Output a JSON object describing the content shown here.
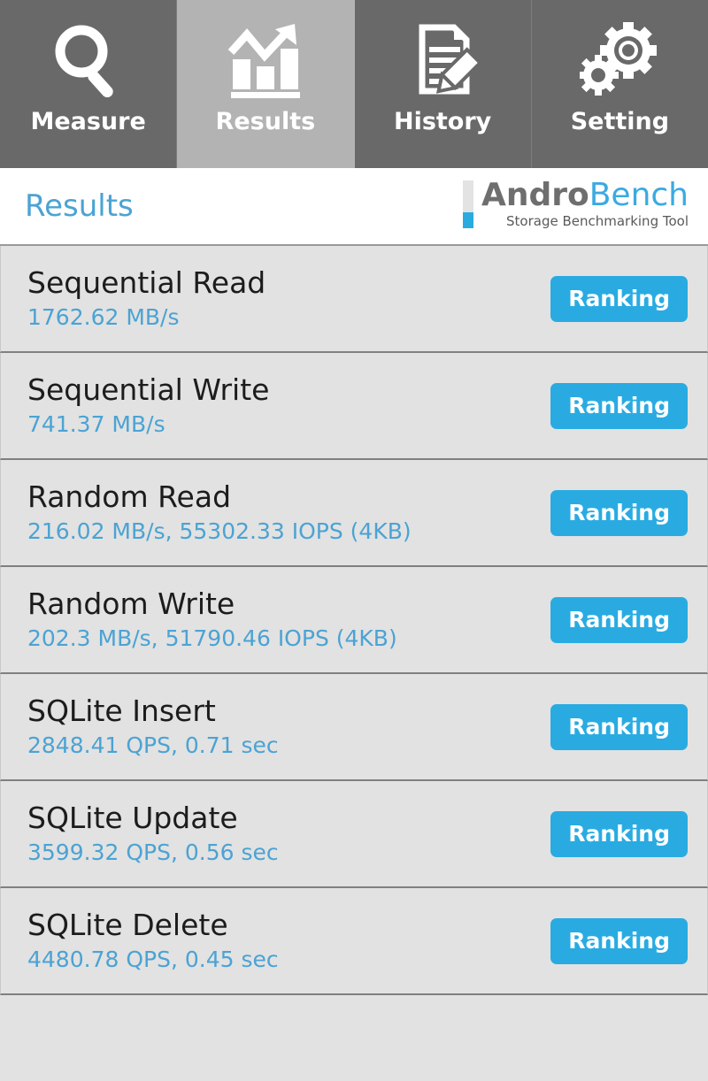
{
  "tabs": [
    {
      "label": "Measure",
      "icon": "magnifier-icon",
      "active": false
    },
    {
      "label": "Results",
      "icon": "bar-chart-trend-icon",
      "active": true
    },
    {
      "label": "History",
      "icon": "document-pencil-icon",
      "active": false
    },
    {
      "label": "Setting",
      "icon": "gears-icon",
      "active": false
    }
  ],
  "header": {
    "title": "Results",
    "logo": {
      "word_first": "Andro",
      "word_second": "Bench",
      "tagline": "Storage Benchmarking Tool"
    }
  },
  "colors": {
    "accent_blue": "#29abe2",
    "value_blue": "#4ba3d3",
    "tab_inactive": "#696969",
    "tab_active": "#b3b3b3",
    "row_background": "#e2e2e2"
  },
  "results": [
    {
      "title": "Sequential Read",
      "value": "1762.62 MB/s",
      "button": "Ranking"
    },
    {
      "title": "Sequential Write",
      "value": "741.37 MB/s",
      "button": "Ranking"
    },
    {
      "title": "Random Read",
      "value": "216.02 MB/s, 55302.33 IOPS (4KB)",
      "button": "Ranking"
    },
    {
      "title": "Random Write",
      "value": "202.3 MB/s, 51790.46 IOPS (4KB)",
      "button": "Ranking"
    },
    {
      "title": "SQLite Insert",
      "value": "2848.41 QPS, 0.71 sec",
      "button": "Ranking"
    },
    {
      "title": "SQLite Update",
      "value": "3599.32 QPS, 0.56 sec",
      "button": "Ranking"
    },
    {
      "title": "SQLite Delete",
      "value": "4480.78 QPS, 0.45 sec",
      "button": "Ranking"
    }
  ]
}
